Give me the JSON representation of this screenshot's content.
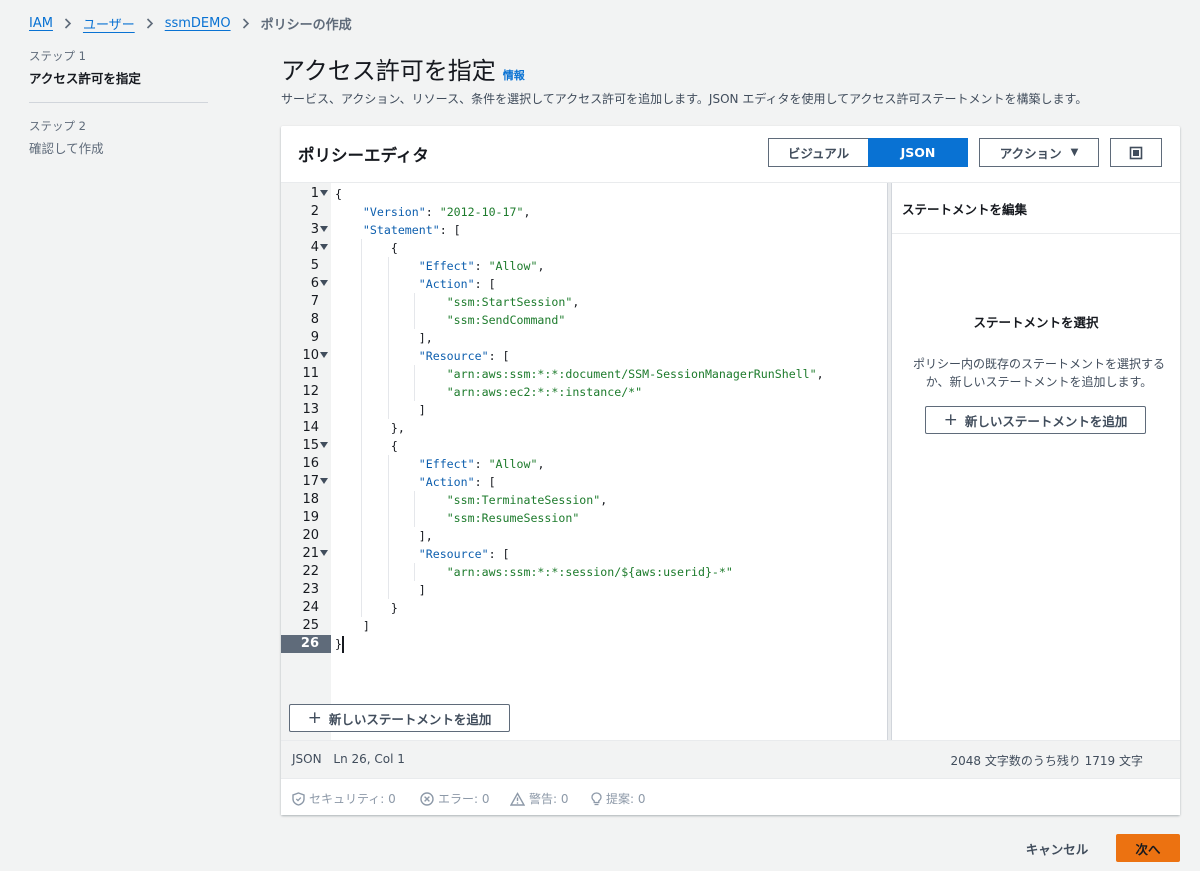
{
  "breadcrumb": {
    "items": [
      "IAM",
      "ユーザー",
      "ssmDEMO"
    ],
    "current": "ポリシーの作成"
  },
  "steps": [
    {
      "label": "ステップ 1",
      "title": "アクセス許可を指定"
    },
    {
      "label": "ステップ 2",
      "title": "確認して作成"
    }
  ],
  "header": {
    "title": "アクセス許可を指定",
    "info": "情報",
    "description": "サービス、アクション、リソース、条件を選択してアクセス許可を追加します。JSON エディタを使用してアクセス許可ステートメントを構築します。"
  },
  "panel": {
    "title": "ポリシーエディタ",
    "visual_label": "ビジュアル",
    "json_label": "JSON",
    "actions_label": "アクション",
    "add_statement": "新しいステートメントを追加"
  },
  "editor": {
    "active_line": 26,
    "lines": [
      {
        "n": "1",
        "fold": true
      },
      {
        "n": "2"
      },
      {
        "n": "3",
        "fold": true
      },
      {
        "n": "4",
        "fold": true
      },
      {
        "n": "5"
      },
      {
        "n": "6",
        "fold": true
      },
      {
        "n": "7"
      },
      {
        "n": "8"
      },
      {
        "n": "9"
      },
      {
        "n": "10",
        "fold": true
      },
      {
        "n": "11"
      },
      {
        "n": "12"
      },
      {
        "n": "13"
      },
      {
        "n": "14"
      },
      {
        "n": "15",
        "fold": true
      },
      {
        "n": "16"
      },
      {
        "n": "17",
        "fold": true
      },
      {
        "n": "18"
      },
      {
        "n": "19"
      },
      {
        "n": "20"
      },
      {
        "n": "21",
        "fold": true
      },
      {
        "n": "22"
      },
      {
        "n": "23"
      },
      {
        "n": "24"
      },
      {
        "n": "25"
      },
      {
        "n": "26"
      }
    ],
    "code": {
      "l1": "{",
      "l2_key": "\"Version\"",
      "l2_val": "\"2012-10-17\"",
      "l3_key": "\"Statement\"",
      "l4": "{",
      "l5_key": "\"Effect\"",
      "l5_val": "\"Allow\"",
      "l6_key": "\"Action\"",
      "l7": "\"ssm:StartSession\"",
      "l8": "\"ssm:SendCommand\"",
      "l9": "],",
      "l10_key": "\"Resource\"",
      "l11": "\"arn:aws:ssm:*:*:document/SSM-SessionManagerRunShell\"",
      "l12": "\"arn:aws:ec2:*:*:instance/*\"",
      "l13": "]",
      "l14": "},",
      "l15": "{",
      "l16_key": "\"Effect\"",
      "l16_val": "\"Allow\"",
      "l17_key": "\"Action\"",
      "l18": "\"ssm:TerminateSession\"",
      "l19": "\"ssm:ResumeSession\"",
      "l20": "],",
      "l21_key": "\"Resource\"",
      "l22": "\"arn:aws:ssm:*:*:session/${aws:userid}-*\"",
      "l23": "]",
      "l24": "}",
      "l25": "]",
      "l26": "}"
    }
  },
  "right_pane": {
    "header": "ステートメントを編集",
    "select_title": "ステートメントを選択",
    "select_desc_1": "ポリシー内の既存のステートメントを選択する",
    "select_desc_2": "か、新しいステートメントを追加します。",
    "add_statement": "新しいステートメントを追加"
  },
  "status": {
    "mode": "JSON",
    "position": "Ln 26, Col 1",
    "remaining": "2048 文字数のうち残り 1719 文字",
    "security": "セキュリティ: 0",
    "errors": "エラー: 0",
    "warnings": "警告: 0",
    "suggestions": "提案: 0"
  },
  "footer": {
    "cancel": "キャンセル",
    "next": "次へ"
  },
  "colors": {
    "link": "#0972d3",
    "primary": "#ec7211",
    "json_key": "#0e5fae",
    "json_string": "#1d7b2c"
  }
}
